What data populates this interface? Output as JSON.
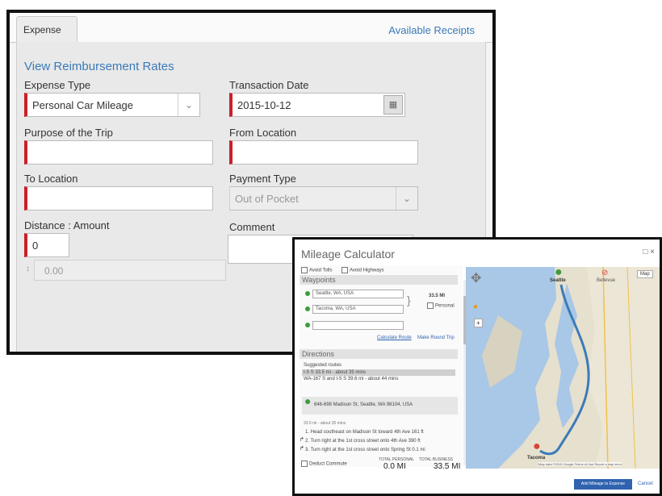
{
  "expense": {
    "tab_label": "Expense",
    "available_receipts": "Available Receipts",
    "rates_link": "View Reimbursement Rates",
    "expense_type": {
      "label": "Expense Type",
      "value": "Personal Car Mileage"
    },
    "transaction_date": {
      "label": "Transaction Date",
      "value": "2015-10-12"
    },
    "purpose": {
      "label": "Purpose of the Trip",
      "value": ""
    },
    "from_location": {
      "label": "From Location",
      "value": ""
    },
    "to_location": {
      "label": "To Location",
      "value": ""
    },
    "payment_type": {
      "label": "Payment Type",
      "value": "Out of Pocket"
    },
    "distance": {
      "label": "Distance : Amount",
      "value": "0",
      "amount": "0.00"
    },
    "comment": {
      "label": "Comment",
      "value": ""
    }
  },
  "mileage": {
    "title": "Mileage Calculator",
    "window_controls": "□ ×",
    "avoid_tolls": "Avoid Tolls",
    "avoid_highways": "Avoid Highways",
    "waypoints_header": "Waypoints",
    "waypoint_1": "Seattle, WA, USA",
    "waypoint_2": "Tacoma, WA, USA",
    "waypoint_3": "",
    "segment_distance": "33.5 MI",
    "personal_label": "Personal",
    "calculate_route": "Calculate Route",
    "make_round_trip": "Make Round Trip",
    "directions_header": "Directions",
    "suggested_routes": "Suggested routes",
    "route_1": "I-5 S  33.5 mi - about 35 mins",
    "route_2": "WA-167 S and I-5 S  39.6 mi - about 44 mins",
    "start_address": "646-698 Madison St, Seattle, WA 98104, USA",
    "leg_summary": "33.5 mi - about 35 mins",
    "steps": [
      "1.  Head southeast on Madison St toward 4th Ave   161 ft",
      "2.  Turn right at the 1st cross street onto 4th Ave   390 ft",
      "3.  Turn right at the 1st cross street onto Spring St  0.1 mi"
    ],
    "deduct_commute": "Deduct Commute",
    "total_personal_label": "TOTAL PERSONAL",
    "total_business_label": "TOTAL BUSINESS",
    "total_personal": "0.0 MI",
    "total_business": "33.5 MI",
    "add_button": "Add Mileage to Expense",
    "cancel": "Cancel",
    "map_type": "Map",
    "map_city_top": "Seattle",
    "map_city_bottom": "Tacoma",
    "map_city_right": "Bellevue",
    "map_footer": "Map data ©2015 Google   Terms of Use   Report a map error"
  }
}
